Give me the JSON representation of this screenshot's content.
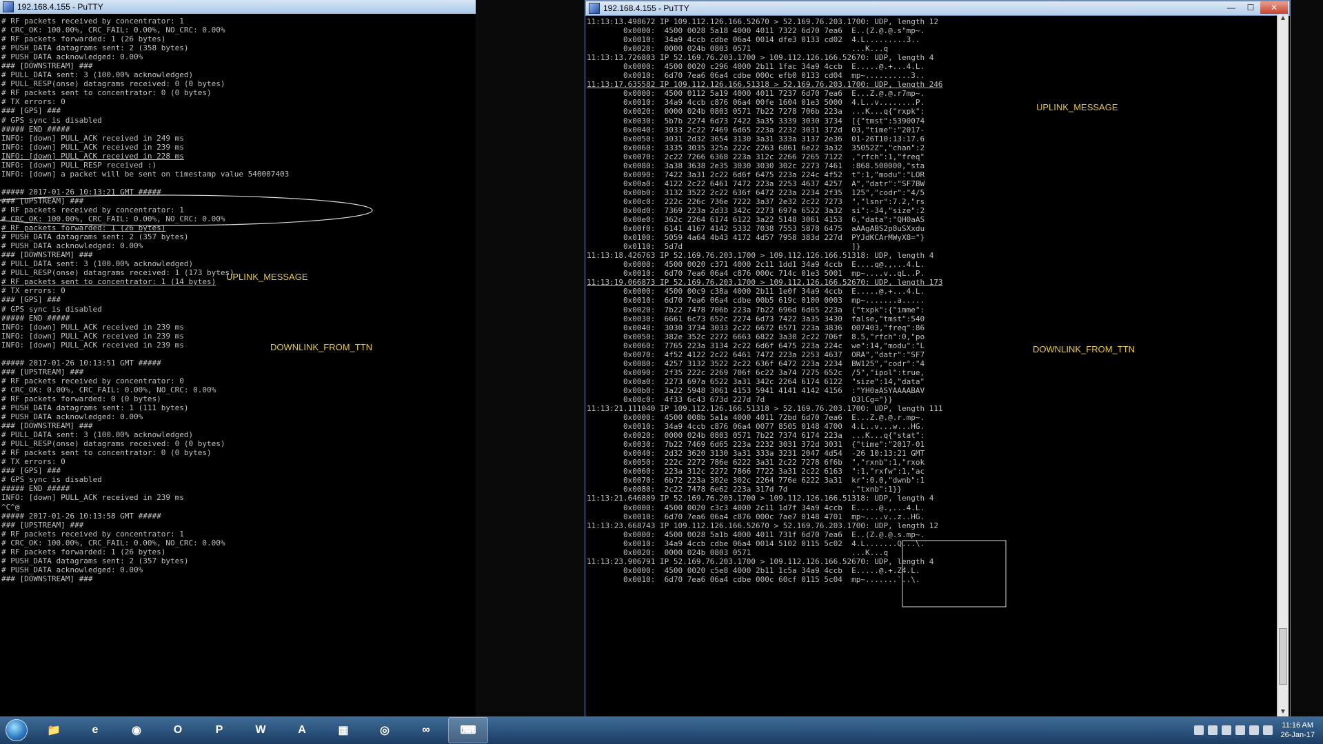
{
  "left_window": {
    "title": "192.168.4.155 - PuTTY",
    "lines": [
      "# RF packets received by concentrator: 1",
      "# CRC_OK: 100.00%, CRC_FAIL: 0.00%, NO_CRC: 0.00%",
      "# RF packets forwarded: 1 (26 bytes)",
      "# PUSH_DATA datagrams sent: 2 (358 bytes)",
      "# PUSH_DATA acknowledged: 0.00%",
      "### [DOWNSTREAM] ###",
      "# PULL_DATA sent: 3 (100.00% acknowledged)",
      "# PULL_RESP(onse) datagrams received: 0 (0 bytes)",
      "# RF packets sent to concentrator: 0 (0 bytes)",
      "# TX errors: 0",
      "### [GPS] ###",
      "# GPS sync is disabled",
      "##### END #####",
      "INFO: [down] PULL_ACK received in 249 ms",
      "INFO: [down] PULL_ACK received in 239 ms",
      "INFO: [down] PULL_ACK received in 228 ms",
      "INFO: [down] PULL_RESP received :)",
      "INFO: [down] a packet will be sent on timestamp value 540007403",
      "",
      "##### 2017-01-26 10:13:21 GMT #####",
      "### [UPSTREAM] ###",
      "# RF packets received by concentrator: 1",
      "# CRC_OK: 100.00%, CRC_FAIL: 0.00%, NO_CRC: 0.00%",
      "# RF packets forwarded: 1 (26 bytes)",
      "# PUSH_DATA datagrams sent: 2 (357 bytes)",
      "# PUSH_DATA acknowledged: 0.00%",
      "### [DOWNSTREAM] ###",
      "# PULL_DATA sent: 3 (100.00% acknowledged)",
      "# PULL_RESP(onse) datagrams received: 1 (173 bytes)",
      "# RF packets sent to concentrator: 1 (14 bytes)",
      "# TX errors: 0",
      "### [GPS] ###",
      "# GPS sync is disabled",
      "##### END #####",
      "INFO: [down] PULL_ACK received in 239 ms",
      "INFO: [down] PULL_ACK received in 239 ms",
      "INFO: [down] PULL_ACK received in 239 ms",
      "",
      "##### 2017-01-26 10:13:51 GMT #####",
      "### [UPSTREAM] ###",
      "# RF packets received by concentrator: 0",
      "# CRC_OK: 0.00%, CRC_FAIL: 0.00%, NO_CRC: 0.00%",
      "# RF packets forwarded: 0 (0 bytes)",
      "# PUSH_DATA datagrams sent: 1 (111 bytes)",
      "# PUSH_DATA acknowledged: 0.00%",
      "### [DOWNSTREAM] ###",
      "# PULL_DATA sent: 3 (100.00% acknowledged)",
      "# PULL_RESP(onse) datagrams received: 0 (0 bytes)",
      "# RF packets sent to concentrator: 0 (0 bytes)",
      "# TX errors: 0",
      "### [GPS] ###",
      "# GPS sync is disabled",
      "##### END #####",
      "INFO: [down] PULL_ACK received in 239 ms",
      "^C^@",
      "##### 2017-01-26 10:13:58 GMT #####",
      "### [UPSTREAM] ###",
      "# RF packets received by concentrator: 1",
      "# CRC_OK: 100.00%, CRC_FAIL: 0.00%, NO_CRC: 0.00%",
      "# RF packets forwarded: 1 (26 bytes)",
      "# PUSH_DATA datagrams sent: 2 (357 bytes)",
      "# PUSH_DATA acknowledged: 0.00%",
      "### [DOWNSTREAM] ###"
    ],
    "annotations": {
      "uplink": "UPLINK_MESSAGE",
      "downlink": "DOWNLINK_FROM_TTN"
    }
  },
  "right_window": {
    "title": "192.168.4.155 - PuTTY",
    "controls": {
      "minimize": "—",
      "maximize": "☐",
      "close": "✕"
    },
    "lines": [
      "11:13:13.498672 IP 109.112.126.166.52670 > 52.169.76.203.1700: UDP, length 12",
      "        0x0000:  4500 0028 5a18 4000 4011 7322 6d70 7ea6  E..(Z.@.@.s\"mp~.",
      "        0x0010:  34a9 4ccb cdbe 06a4 0014 dfe3 0133 cd02  4.L.........3..",
      "        0x0020:  0000 024b 0803 0571                      ...K...q",
      "11:13:13.726803 IP 52.169.76.203.1700 > 109.112.126.166.52670: UDP, length 4",
      "        0x0000:  4500 0020 c296 4000 2b11 1fac 34a9 4ccb  E.....@.+...4.L.",
      "        0x0010:  6d70 7ea6 06a4 cdbe 000c efb0 0133 cd04  mp~..........3..",
      "11:13:17.635582 IP 109.112.126.166.51318 > 52.169.76.203.1700: UDP, length 246",
      "        0x0000:  4500 0112 5a19 4000 4011 7237 6d70 7ea6  E...Z.@.@.r7mp~.",
      "        0x0010:  34a9 4ccb c876 06a4 00fe 1604 01e3 5000  4.L..v........P.",
      "        0x0020:  0000 024b 0803 0571 7b22 7278 706b 223a  ...K...q{\"rxpk\":",
      "        0x0030:  5b7b 2274 6d73 7422 3a35 3339 3030 3734  [{\"tmst\":5390074",
      "        0x0040:  3033 2c22 7469 6d65 223a 2232 3031 372d  03,\"time\":\"2017-",
      "        0x0050:  3031 2d32 3654 3130 3a31 333a 3137 2e36  01-26T10:13:17.6",
      "        0x0060:  3335 3035 325a 222c 2263 6861 6e22 3a32  35052Z\",\"chan\":2",
      "        0x0070:  2c22 7266 6368 223a 312c 2266 7265 7122  ,\"rfch\":1,\"freq\"",
      "        0x0080:  3a38 3638 2e35 3030 3030 302c 2273 7461  :868.500000,\"sta",
      "        0x0090:  7422 3a31 2c22 6d6f 6475 223a 224c 4f52  t\":1,\"modu\":\"LOR",
      "        0x00a0:  4122 2c22 6461 7472 223a 2253 4637 4257  A\",\"datr\":\"SF7BW",
      "        0x00b0:  3132 3522 2c22 636f 6472 223a 2234 2f35  125\",\"codr\":\"4/5",
      "        0x00c0:  222c 226c 736e 7222 3a37 2e32 2c22 7273  \",\"lsnr\":7.2,\"rs",
      "        0x00d0:  7369 223a 2d33 342c 2273 697a 6522 3a32  si\":-34,\"size\":2",
      "        0x00e0:  362c 2264 6174 6122 3a22 5148 3061 4153  6,\"data\":\"QH0aAS",
      "        0x00f0:  6141 4167 4142 5332 7038 7553 5878 6475  aAAgABS2p8uSXxdu",
      "        0x0100:  5059 4a64 4b43 4172 4d57 7958 383d 227d  PYJdKCArMWyX8=\"}",
      "        0x0110:  5d7d                                     ]}",
      "11:13:18.426763 IP 52.169.76.203.1700 > 109.112.126.166.51318: UDP, length 4",
      "        0x0000:  4500 0020 c371 4000 2c11 1dd1 34a9 4ccb  E....q@.,...4.L.",
      "        0x0010:  6d70 7ea6 06a4 c876 000c 714c 01e3 5001  mp~....v..qL..P.",
      "11:13:19.066873 IP 52.169.76.203.1700 > 109.112.126.166.52670: UDP, length 173",
      "        0x0000:  4500 00c9 c38a 4000 2b11 1e0f 34a9 4ccb  E.....@.+...4.L.",
      "        0x0010:  6d70 7ea6 06a4 cdbe 00b5 619c 0100 0003  mp~.......a.....",
      "        0x0020:  7b22 7478 706b 223a 7b22 696d 6d65 223a  {\"txpk\":{\"imme\":",
      "        0x0030:  6661 6c73 652c 2274 6d73 7422 3a35 3430  false,\"tmst\":540",
      "        0x0040:  3030 3734 3033 2c22 6672 6571 223a 3836  007403,\"freq\":86",
      "        0x0050:  382e 352c 2272 6663 6822 3a30 2c22 706f  8.5,\"rfch\":0,\"po",
      "        0x0060:  7765 223a 3134 2c22 6d6f 6475 223a 224c  we\":14,\"modu\":\"L",
      "        0x0070:  4f52 4122 2c22 6461 7472 223a 2253 4637  ORA\",\"datr\":\"SF7",
      "        0x0080:  4257 3132 3522 2c22 636f 6472 223a 2234  BW125\",\"codr\":\"4",
      "        0x0090:  2f35 222c 2269 706f 6c22 3a74 7275 652c  /5\",\"ipol\":true,",
      "        0x00a0:  2273 697a 6522 3a31 342c 2264 6174 6122  \"size\":14,\"data\"",
      "        0x00b0:  3a22 5948 3061 4153 5941 4141 4142 4156  :\"YH0aASYAAAABAV",
      "        0x00c0:  4f33 6c43 673d 227d 7d                   O3lCg=\"}}",
      "11:13:21.111040 IP 109.112.126.166.51318 > 52.169.76.203.1700: UDP, length 111",
      "        0x0000:  4500 008b 5a1a 4000 4011 72bd 6d70 7ea6  E...Z.@.@.r.mp~.",
      "        0x0010:  34a9 4ccb c876 06a4 0077 8505 0148 4700  4.L..v...w...HG.",
      "        0x0020:  0000 024b 0803 0571 7b22 7374 6174 223a  ...K...q{\"stat\":",
      "        0x0030:  7b22 7469 6d65 223a 2232 3031 372d 3031  {\"time\":\"2017-01",
      "        0x0040:  2d32 3620 3130 3a31 333a 3231 2047 4d54  -26 10:13:21 GMT",
      "        0x0050:  222c 2272 786e 6222 3a31 2c22 7278 6f6b  \",\"rxnb\":1,\"rxok",
      "        0x0060:  223a 312c 2272 7866 7722 3a31 2c22 6163  \":1,\"rxfw\":1,\"ac",
      "        0x0070:  6b72 223a 302e 302c 2264 776e 6222 3a31  kr\":0.0,\"dwnb\":1",
      "        0x0080:  2c22 7478 6e62 223a 317d 7d              ,\"txnb\":1}}",
      "11:13:21.646809 IP 52.169.76.203.1700 > 109.112.126.166.51318: UDP, length 4",
      "        0x0000:  4500 0020 c3c3 4000 2c11 1d7f 34a9 4ccb  E.....@.,...4.L.",
      "        0x0010:  6d70 7ea6 06a4 c876 000c 7ae7 0148 4701  mp~....v..z..HG.",
      "11:13:23.668743 IP 109.112.126.166.52670 > 52.169.76.203.1700: UDP, length 12",
      "        0x0000:  4500 0028 5a1b 4000 4011 731f 6d70 7ea6  E..(Z.@.@.s.mp~.",
      "        0x0010:  34a9 4ccb cdbe 06a4 0014 5102 0115 5c02  4.L.......Q...\\.",
      "        0x0020:  0000 024b 0803 0571                      ...K...q",
      "11:13:23.906791 IP 52.169.76.203.1700 > 109.112.126.166.52670: UDP, length 4",
      "        0x0000:  4500 0020 c5e8 4000 2b11 1c5a 34a9 4ccb  E.....@.+.Z4.L.",
      "        0x0010:  6d70 7ea6 06a4 cdbe 000c 60cf 0115 5c04  mp~.......`..\\."
    ],
    "annotations": {
      "uplink": "UPLINK_MESSAGE",
      "downlink": "DOWNLINK_FROM_TTN"
    }
  },
  "taskbar": {
    "clock_time": "11:16 AM",
    "clock_date": "26-Jan-17",
    "apps": [
      {
        "name": "explorer",
        "glyph": "📁"
      },
      {
        "name": "internet-explorer",
        "glyph": "e"
      },
      {
        "name": "chrome",
        "glyph": "◉"
      },
      {
        "name": "outlook",
        "glyph": "O"
      },
      {
        "name": "powerpoint",
        "glyph": "P"
      },
      {
        "name": "word",
        "glyph": "W"
      },
      {
        "name": "acrobat",
        "glyph": "A"
      },
      {
        "name": "calculator",
        "glyph": "▦"
      },
      {
        "name": "app-blue",
        "glyph": "◎"
      },
      {
        "name": "arduino",
        "glyph": "∞"
      },
      {
        "name": "putty",
        "glyph": "⌨"
      }
    ]
  },
  "colors": {
    "terminal_bg": "#000000",
    "terminal_fg": "#c0c0c0",
    "annotation": "#e8c84a"
  }
}
